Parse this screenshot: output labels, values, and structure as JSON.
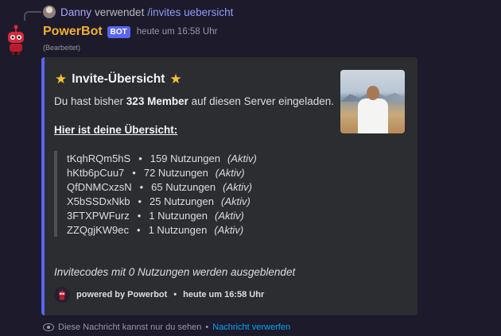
{
  "reply": {
    "user": "Danny",
    "verb": "verwendet",
    "command": "/invites uebersicht"
  },
  "message": {
    "author": "PowerBot",
    "badge": "BOT",
    "timestamp": "heute um 16:58 Uhr",
    "edited": "(Bearbeitet)"
  },
  "embed": {
    "title": "Invite-Übersicht",
    "title_icon": "star-icon",
    "desc_prefix": "Du hast bisher ",
    "desc_bold": "323 Member",
    "desc_suffix": " auf diesen Server eingeladen.",
    "overview_heading": "Hier ist deine Übersicht:",
    "invites": [
      {
        "code": "tKqhRQm5hS",
        "uses": "159 Nutzungen",
        "status": "(Aktiv)"
      },
      {
        "code": "hKtb6pCuu7",
        "uses": "72 Nutzungen",
        "status": "(Aktiv)"
      },
      {
        "code": "QfDNMCxzsN",
        "uses": "65 Nutzungen",
        "status": "(Aktiv)"
      },
      {
        "code": "X5bSSDxNkb",
        "uses": "25 Nutzungen",
        "status": "(Aktiv)"
      },
      {
        "code": "3FTXPWFurz",
        "uses": "1 Nutzungen",
        "status": "(Aktiv)"
      },
      {
        "code": "ZZQgjKW9ec",
        "uses": "1 Nutzungen",
        "status": "(Aktiv)"
      }
    ],
    "separator": "•",
    "hidden_note": "Invitecodes mit 0 Nutzungen werden ausgeblendet",
    "footer_text": "powered by Powerbot",
    "footer_sep": "•",
    "footer_time": "heute um 16:58 Uhr",
    "accent_color": "#5865f2"
  },
  "ephemeral": {
    "text": "Diese Nachricht kannst nur du sehen",
    "sep": "•",
    "dismiss": "Nachricht verwerfen"
  },
  "colors": {
    "bot_name": "#f0b132",
    "link": "#00a8fc",
    "command": "#8f9cf8"
  }
}
